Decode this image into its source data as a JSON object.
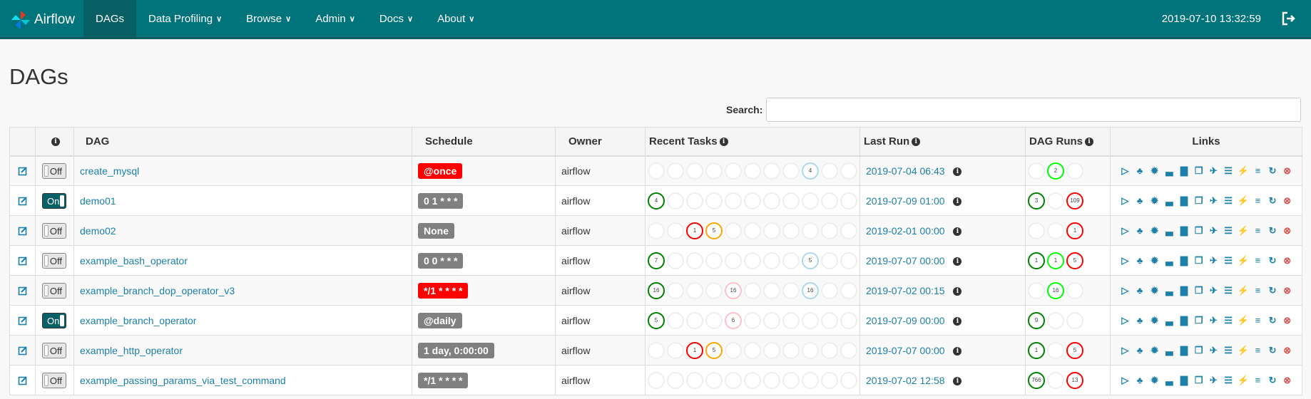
{
  "navbar": {
    "brand": "Airflow",
    "items": [
      {
        "label": "DAGs",
        "caret": false,
        "active": true
      },
      {
        "label": "Data Profiling",
        "caret": true
      },
      {
        "label": "Browse",
        "caret": true
      },
      {
        "label": "Admin",
        "caret": true
      },
      {
        "label": "Docs",
        "caret": true
      },
      {
        "label": "About",
        "caret": true
      }
    ],
    "time": "2019-07-10 13:32:59"
  },
  "page_title": "DAGs",
  "search": {
    "label": "Search:",
    "value": ""
  },
  "columns": [
    "",
    "i",
    "DAG",
    "Schedule",
    "Owner",
    "Recent Tasks",
    "Last Run",
    "DAG Runs",
    "Links"
  ],
  "colors": {
    "success": "#008000",
    "running": "#00ff00",
    "failed": "#ff0000",
    "upstream_failed": "#ffa500",
    "skipped": "#ffc0cb",
    "queued": "#808080",
    "up_for_retry": "#add8e6",
    "none": "#eeeeee",
    "link": "#1d80a8",
    "brand": "#00737b"
  },
  "rows": [
    {
      "dag": "create_mysql",
      "on": false,
      "toggle": "Off",
      "schedule": "@once",
      "sched_color": "#ff0000",
      "owner": "airflow",
      "recent": [
        "",
        "",
        "",
        "",
        "",
        "",
        "",
        "",
        "4",
        "",
        ""
      ],
      "recent_st": [
        "none",
        "none",
        "none",
        "none",
        "none",
        "none",
        "none",
        "none",
        "up_for_retry",
        "none",
        "none"
      ],
      "last_run": "2019-07-04 06:43",
      "runs": [
        "",
        "2",
        ""
      ],
      "runs_st": [
        "none",
        "running",
        "none"
      ]
    },
    {
      "dag": "demo01",
      "on": true,
      "toggle": "On",
      "schedule": "0 1 * * *",
      "sched_color": "#808080",
      "owner": "airflow",
      "recent": [
        "4",
        "",
        "",
        "",
        "",
        "",
        "",
        "",
        "",
        "",
        ""
      ],
      "recent_st": [
        "success",
        "none",
        "none",
        "none",
        "none",
        "none",
        "none",
        "none",
        "none",
        "none",
        "none"
      ],
      "last_run": "2019-07-09 01:00",
      "runs": [
        "3",
        "",
        "109"
      ],
      "runs_st": [
        "success",
        "none",
        "failed"
      ]
    },
    {
      "dag": "demo02",
      "on": false,
      "toggle": "Off",
      "schedule": "None",
      "sched_color": "#808080",
      "owner": "airflow",
      "recent": [
        "",
        "",
        "1",
        "5",
        "",
        "",
        "",
        "",
        "",
        "",
        ""
      ],
      "recent_st": [
        "none",
        "none",
        "failed",
        "upstream_failed",
        "none",
        "none",
        "none",
        "none",
        "none",
        "none",
        "none"
      ],
      "last_run": "2019-02-01 00:00",
      "runs": [
        "",
        "",
        "1"
      ],
      "runs_st": [
        "none",
        "none",
        "failed"
      ]
    },
    {
      "dag": "example_bash_operator",
      "on": false,
      "toggle": "Off",
      "schedule": "0 0 * * *",
      "sched_color": "#808080",
      "owner": "airflow",
      "recent": [
        "7",
        "",
        "",
        "",
        "",
        "",
        "",
        "",
        "5",
        "",
        ""
      ],
      "recent_st": [
        "success",
        "none",
        "none",
        "none",
        "none",
        "none",
        "none",
        "none",
        "up_for_retry",
        "none",
        "none"
      ],
      "last_run": "2019-07-07 00:00",
      "runs": [
        "1",
        "1",
        "5"
      ],
      "runs_st": [
        "success",
        "running",
        "failed"
      ]
    },
    {
      "dag": "example_branch_dop_operator_v3",
      "on": false,
      "toggle": "Off",
      "schedule": "*/1 * * * *",
      "sched_color": "#ff0000",
      "owner": "airflow",
      "recent": [
        "16",
        "",
        "",
        "",
        "16",
        "",
        "",
        "",
        "16",
        "",
        ""
      ],
      "recent_st": [
        "success",
        "none",
        "none",
        "none",
        "skipped",
        "none",
        "none",
        "none",
        "up_for_retry",
        "none",
        "none"
      ],
      "last_run": "2019-07-02 00:15",
      "runs": [
        "",
        "16",
        ""
      ],
      "runs_st": [
        "none",
        "running",
        "none"
      ]
    },
    {
      "dag": "example_branch_operator",
      "on": true,
      "toggle": "On",
      "schedule": "@daily",
      "sched_color": "#808080",
      "owner": "airflow",
      "recent": [
        "5",
        "",
        "",
        "",
        "6",
        "",
        "",
        "",
        "",
        "",
        ""
      ],
      "recent_st": [
        "success",
        "none",
        "none",
        "none",
        "skipped",
        "none",
        "none",
        "none",
        "none",
        "none",
        "none"
      ],
      "last_run": "2019-07-09 00:00",
      "runs": [
        "9",
        "",
        ""
      ],
      "runs_st": [
        "success",
        "none",
        "none"
      ]
    },
    {
      "dag": "example_http_operator",
      "on": false,
      "toggle": "Off",
      "schedule": "1 day, 0:00:00",
      "sched_color": "#808080",
      "owner": "airflow",
      "recent": [
        "",
        "",
        "1",
        "5",
        "",
        "",
        "",
        "",
        "",
        "",
        ""
      ],
      "recent_st": [
        "none",
        "none",
        "failed",
        "upstream_failed",
        "none",
        "none",
        "none",
        "none",
        "none",
        "none",
        "none"
      ],
      "last_run": "2019-07-07 00:00",
      "runs": [
        "1",
        "",
        "5"
      ],
      "runs_st": [
        "success",
        "none",
        "failed"
      ]
    },
    {
      "dag": "example_passing_params_via_test_command",
      "on": false,
      "toggle": "Off",
      "schedule": "*/1 * * * *",
      "sched_color": "#808080",
      "owner": "airflow",
      "recent": [
        "",
        "",
        "",
        "",
        "",
        "",
        "",
        "",
        "",
        "",
        ""
      ],
      "recent_st": [
        "none",
        "none",
        "none",
        "none",
        "none",
        "none",
        "none",
        "none",
        "none",
        "none",
        "none"
      ],
      "last_run": "2019-07-02 12:58",
      "runs": [
        "766",
        "",
        "13"
      ],
      "runs_st": [
        "success",
        "none",
        "failed"
      ]
    }
  ],
  "link_icons": [
    "trigger-dag",
    "tree-view",
    "graph-view",
    "tries",
    "duration",
    "landing-times",
    "gantt",
    "code-view",
    "logs",
    "refresh",
    "delete"
  ]
}
